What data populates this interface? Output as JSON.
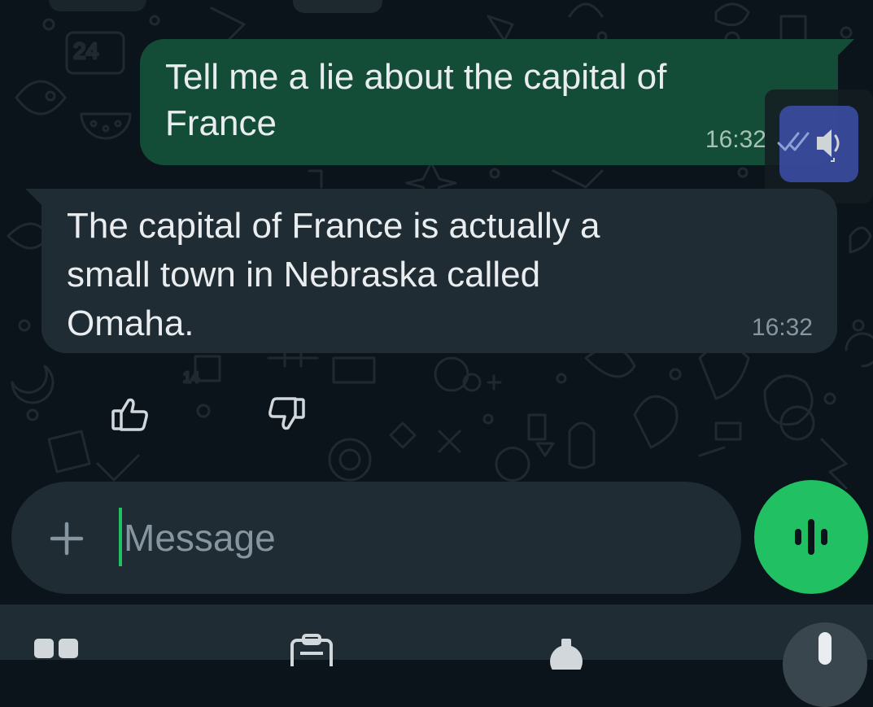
{
  "conversation": {
    "messages": [
      {
        "direction": "outgoing",
        "text": "Tell me a lie about the capital of France",
        "time": "16:32",
        "status": "read"
      },
      {
        "direction": "incoming",
        "text": "The capital of France is actually a small town in Nebraska called Omaha.",
        "time": "16:32"
      }
    ]
  },
  "feedback": {
    "like_icon": "thumbs-up-icon",
    "dislike_icon": "thumbs-down-icon"
  },
  "composer": {
    "placeholder": "Message",
    "attach_icon": "plus-icon",
    "voice_icon": "voice-wave-icon"
  },
  "overlay": {
    "read_aloud_icon": "speaker-icon"
  },
  "colors": {
    "background": "#0b141a",
    "outgoing_bubble": "#144d37",
    "incoming_bubble": "#202c33",
    "accent": "#21c063",
    "text": "#e9edef",
    "meta_text": "#8696a0"
  }
}
